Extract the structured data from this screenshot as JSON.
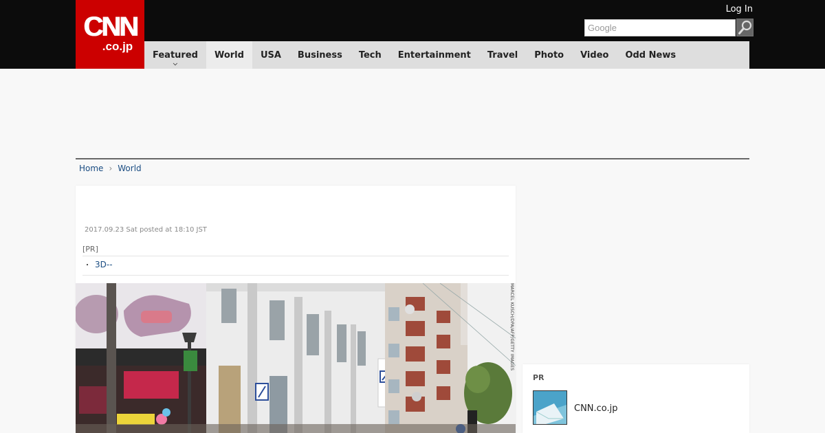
{
  "header": {
    "logo_main": "CNN",
    "logo_sub": ".co.jp",
    "login_label": "Log In",
    "search_placeholder": "Google",
    "search_icon": "magnifier-icon",
    "brand_color": "#cc0000"
  },
  "nav": {
    "items": [
      {
        "label": "Featured"
      },
      {
        "label": "World"
      },
      {
        "label": "USA"
      },
      {
        "label": "Business"
      },
      {
        "label": "Tech"
      },
      {
        "label": "Entertainment"
      },
      {
        "label": "Travel"
      },
      {
        "label": "Photo"
      },
      {
        "label": "Video"
      },
      {
        "label": "Odd News"
      }
    ],
    "active_index": 1
  },
  "breadcrumb": {
    "home": "Home",
    "current": "World"
  },
  "article": {
    "date": "2017.09.23 Sat posted at 18:10 JST",
    "pr_label": "[PR]",
    "pr_link": "3D--",
    "photo_credit": "MARCEL KUSCH/DPA/AFP/GETTY IMAGES"
  },
  "sidebar": {
    "pr_title": "PR",
    "pr_item_text": "CNN.co.jp"
  }
}
